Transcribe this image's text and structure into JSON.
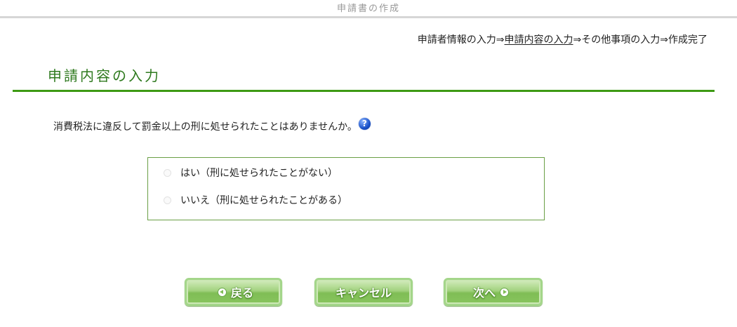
{
  "window": {
    "title": "申請書の作成"
  },
  "steps": {
    "step1": "申請者情報の入力",
    "sep1": "⇒",
    "step2": "申請内容の入力",
    "sep2": "⇒",
    "step3": "その他事項の入力",
    "sep3": "⇒",
    "step4": "作成完了",
    "current_index": 2
  },
  "section": {
    "title": "申請内容の入力"
  },
  "question": {
    "text": "消費税法に違反して罰金以上の刑に処せられたことはありませんか。",
    "help_icon": "question-help-icon"
  },
  "options": [
    {
      "label": "はい（刑に処せられたことがない）",
      "selected": false
    },
    {
      "label": "いいえ（刑に処せられたことがある）",
      "selected": false
    }
  ],
  "buttons": {
    "back": "戻る",
    "cancel": "キャンセル",
    "next": "次へ"
  },
  "colors": {
    "accent_green": "#3d9a14",
    "title_green": "#2f7a1f",
    "button_green": "#88c55e"
  }
}
